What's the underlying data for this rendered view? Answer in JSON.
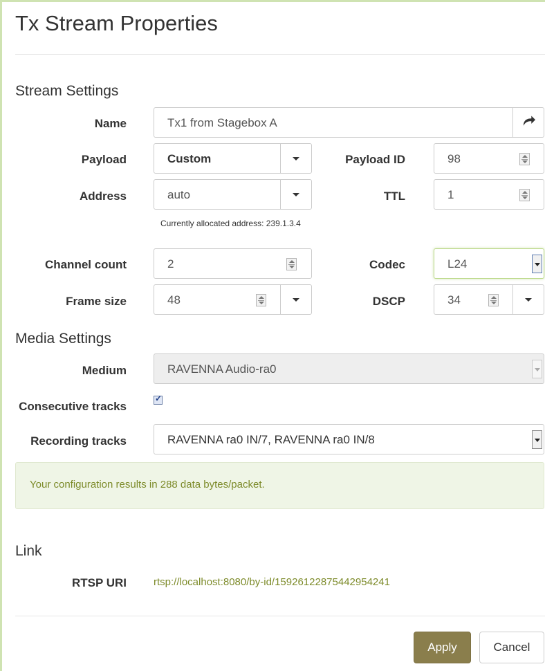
{
  "dialog": {
    "title": "Tx Stream Properties"
  },
  "stream_settings": {
    "heading": "Stream Settings",
    "name": {
      "label": "Name",
      "value": "Tx1 from Stagebox A",
      "icon": "share-icon"
    },
    "payload": {
      "label": "Payload",
      "value": "Custom",
      "icon": "chevron-down-icon"
    },
    "payload_id": {
      "label": "Payload ID",
      "value": "98"
    },
    "address": {
      "label": "Address",
      "value": "auto",
      "hint": "Currently allocated address: 239.1.3.4"
    },
    "ttl": {
      "label": "TTL",
      "value": "1"
    },
    "channel_count": {
      "label": "Channel count",
      "value": "2"
    },
    "codec": {
      "label": "Codec",
      "value": "L24"
    },
    "frame_size": {
      "label": "Frame size",
      "value": "48"
    },
    "dscp": {
      "label": "DSCP",
      "value": "34"
    }
  },
  "media_settings": {
    "heading": "Media Settings",
    "medium": {
      "label": "Medium",
      "value": "RAVENNA Audio-ra0"
    },
    "consecutive_tracks": {
      "label": "Consecutive tracks",
      "checked": true
    },
    "recording_tracks": {
      "label": "Recording tracks",
      "value": "RAVENNA ra0 IN/7, RAVENNA ra0 IN/8"
    }
  },
  "info": {
    "message": "Your configuration results in 288 data bytes/packet."
  },
  "link": {
    "heading": "Link",
    "rtsp": {
      "label": "RTSP URI",
      "value": "rtsp://localhost:8080/by-id/15926122875442954241"
    }
  },
  "buttons": {
    "apply": "Apply",
    "cancel": "Cancel"
  },
  "colors": {
    "accent": "#8a7e4c",
    "info_text": "#7d8b2a",
    "info_bg": "#eff5e6",
    "border_highlight": "#cfe3b2"
  }
}
